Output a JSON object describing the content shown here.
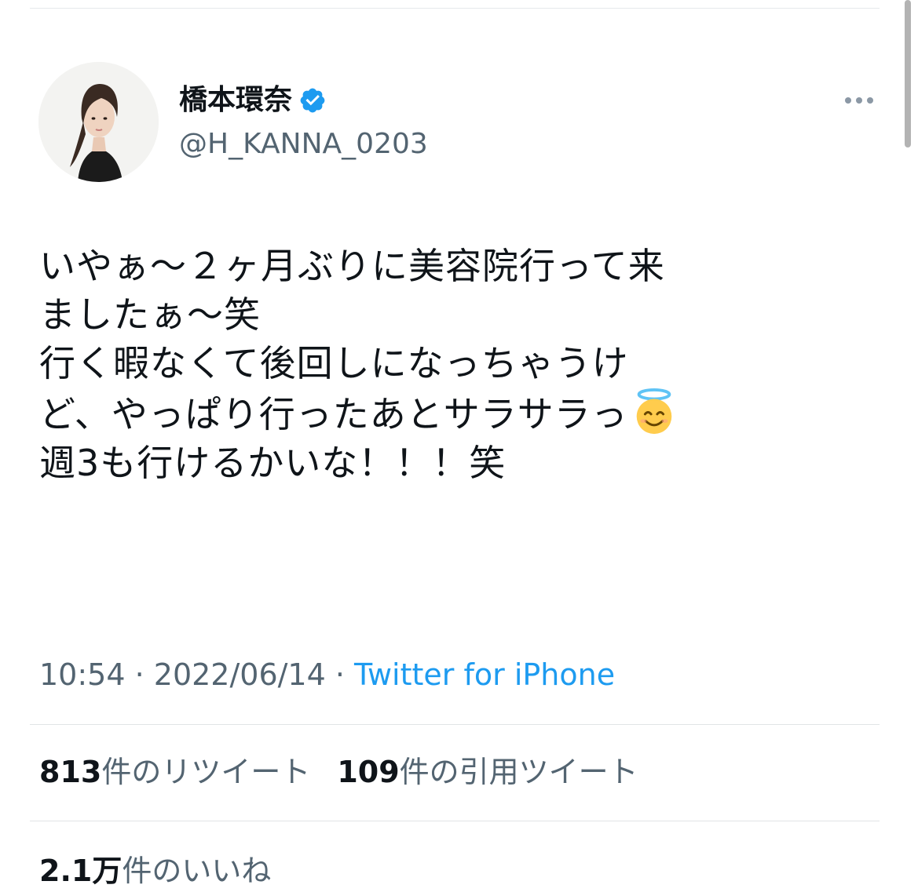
{
  "colors": {
    "link": "#1d9bf0",
    "secondary_text": "#536471",
    "verified": "#1d9bf0"
  },
  "author": {
    "display_name": "橋本環奈",
    "handle": "@H_KANNA_0203",
    "verified_icon": "verified-badge-icon",
    "avatar": "profile-photo"
  },
  "more_icon": "more-options-icon",
  "tweet": {
    "lines": [
      "いやぁ〜２ヶ月ぶりに美容院行って来",
      "ましたぁ〜笑",
      "行く暇なくて後回しになっちゃうけ",
      "ど、やっぱり行ったあとサラサラっ",
      "週3も行けるかいな！！！笑"
    ],
    "emoji": "smiling-face-with-halo-icon"
  },
  "meta": {
    "time": "10:54",
    "separator": " · ",
    "date": "2022/06/14",
    "source": "Twitter for iPhone"
  },
  "stats": {
    "retweets": {
      "count": "813",
      "label": "件のリツイート"
    },
    "quotes": {
      "count": "109",
      "label": "件の引用ツイート"
    },
    "likes": {
      "count": "2.1万",
      "label": "件のいいね"
    }
  }
}
